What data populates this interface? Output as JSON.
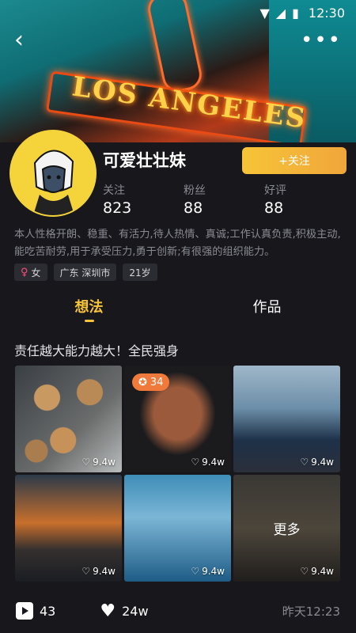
{
  "status_bar": {
    "time": "12:30"
  },
  "profile": {
    "name": "可爱壮壮妹",
    "follow_label": "+关注",
    "stats": [
      {
        "label": "关注",
        "value": "823"
      },
      {
        "label": "粉丝",
        "value": "88"
      },
      {
        "label": "好评",
        "value": "88"
      }
    ],
    "bio": "本人性格开朗、稳重、有活力,待人热情、真诚;工作认真负责,积极主动,能吃苦耐劳,用于承受压力,勇于创新;有很强的组织能力。",
    "tags": {
      "gender": "女",
      "location": "广东 深圳市",
      "age": "21岁"
    }
  },
  "tabs": [
    {
      "label": "想法",
      "active": true
    },
    {
      "label": "作品",
      "active": false
    }
  ],
  "post": {
    "title": "责任越大能力越大！全民强身",
    "images": [
      {
        "likes": "9.4w"
      },
      {
        "likes": "9.4w",
        "badge": "34"
      },
      {
        "likes": "9.4w"
      },
      {
        "likes": "9.4w"
      },
      {
        "likes": "9.4w"
      },
      {
        "likes": "9.4w",
        "overlay": "更多"
      }
    ],
    "views": "43",
    "hearts": "24w",
    "time": "昨天12:23"
  },
  "colors": {
    "accent": "#f7c438",
    "background": "#17171c",
    "muted_text": "#8a8a92"
  }
}
